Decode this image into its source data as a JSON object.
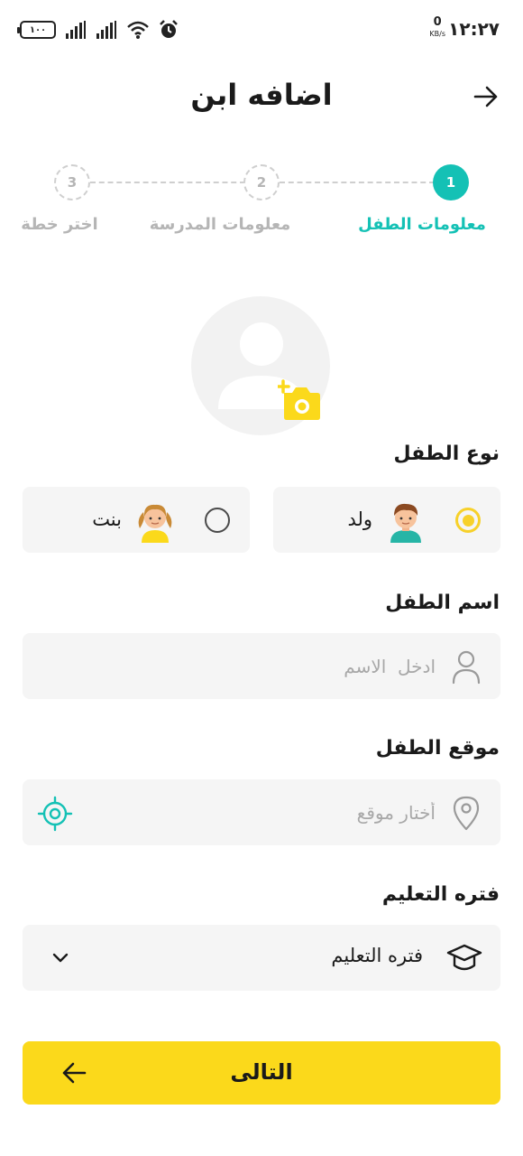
{
  "status_bar": {
    "time": "١٢:٢٧",
    "speed_value": "0",
    "speed_unit": "KB/s",
    "battery": "١٠٠"
  },
  "header": {
    "title": "اضافه ابن",
    "back_icon": "arrow-right-icon"
  },
  "stepper": {
    "steps": [
      {
        "number": "1",
        "label": "معلومات الطفل",
        "state": "active"
      },
      {
        "number": "2",
        "label": "معلومات المدرسة",
        "state": "inactive"
      },
      {
        "number": "3",
        "label": "اختر خطة",
        "state": "inactive"
      }
    ]
  },
  "avatar": {
    "placeholder_icon": "user-silhouette-icon",
    "camera_icon": "add-camera-icon"
  },
  "gender": {
    "label": "نوع الطفل",
    "options": [
      {
        "label": "ولد",
        "icon": "boy-icon",
        "selected": true
      },
      {
        "label": "بنت",
        "icon": "girl-icon",
        "selected": false
      }
    ]
  },
  "child_name": {
    "label": "اسم الطفل",
    "placeholder": "ادخل  الاسم",
    "value": ""
  },
  "location": {
    "label": "موقع الطفل",
    "placeholder": "أختار موقع",
    "value": ""
  },
  "study_period": {
    "label": "فتره التعليم",
    "selected": "فتره التعليم"
  },
  "next_button": {
    "label": "التالى"
  },
  "colors": {
    "accent_teal": "#14c1b5",
    "accent_yellow": "#fbd91b",
    "field_bg": "#f5f5f5",
    "muted_text": "#b5b5b5"
  }
}
